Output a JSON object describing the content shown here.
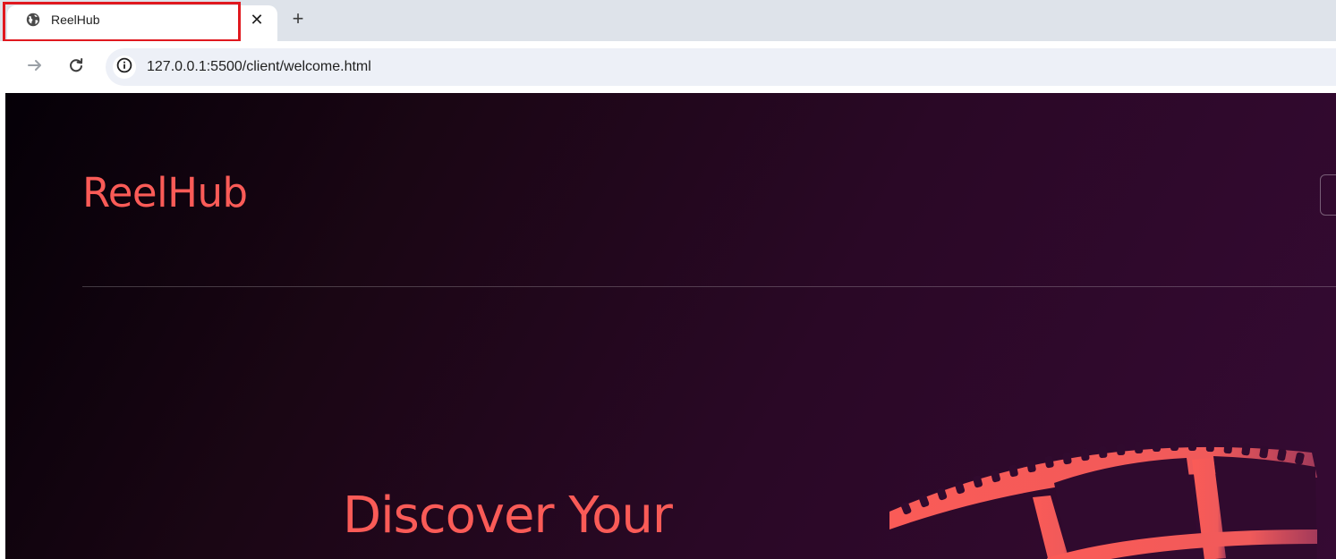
{
  "browser": {
    "tab": {
      "title": "ReelHub",
      "close_glyph": "✕",
      "favicon": "globe-icon"
    },
    "new_tab_glyph": "+",
    "toolbar": {
      "forward_icon": "arrow-right-icon",
      "reload_icon": "reload-icon",
      "site_info_icon": "info-icon"
    },
    "url": "127.0.0.1:5500/client/welcome.html"
  },
  "page": {
    "brand": "ReelHub",
    "hero_heading": "Discover Your",
    "hero_graphic": "film-strip-icon"
  },
  "colors": {
    "accent": "#fa5b57",
    "page_gradient_start": "#050007",
    "page_gradient_end": "#350a33",
    "tab_highlight": "#e0191f",
    "tabstrip_bg": "#dee3ea",
    "omnibox_bg": "#edf0f7"
  }
}
